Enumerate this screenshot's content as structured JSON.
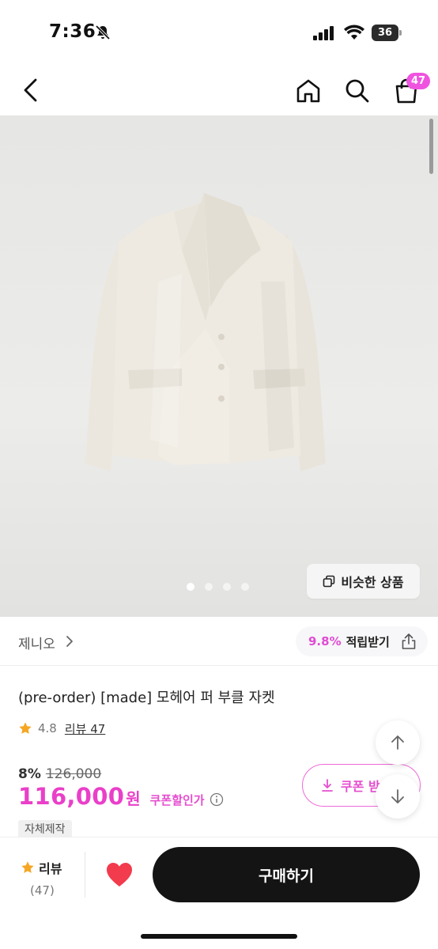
{
  "status_bar": {
    "time": "7:36",
    "battery": "36",
    "icons": [
      "bell-slash-icon",
      "signal-icon",
      "wifi-icon",
      "battery-icon"
    ]
  },
  "header": {
    "icons": [
      "back-icon",
      "home-icon",
      "search-icon",
      "cart-icon"
    ],
    "cart_count": "47",
    "badge_color": "#f053e0"
  },
  "gallery": {
    "image_subject": "cream mohair jacket",
    "dot_count": 4,
    "active_dot": 0,
    "similar_button_label": "비슷한 상품"
  },
  "brand": {
    "name": "제니오",
    "reward_percent": "9.8%",
    "reward_label": "적립받기"
  },
  "product": {
    "title": "(pre-order) [made] 모헤어 퍼 부클 자켓",
    "rating": "4.8",
    "review_label": "리뷰 47",
    "discount_percent": "8%",
    "original_price": "126,000",
    "price": "116,000",
    "price_unit": "원",
    "coupon_discount_label": "쿠폰할인가",
    "tag": "자체제작",
    "coupon_button_label": "쿠폰 받"
  },
  "bottom_bar": {
    "review_label": "리뷰",
    "review_count": "(47)",
    "buy_label": "구매하기"
  },
  "colors": {
    "accent_pink": "#ea3fc9",
    "buy_button": "#141414",
    "heart": "#f23b4c",
    "star": "#f5a623"
  }
}
